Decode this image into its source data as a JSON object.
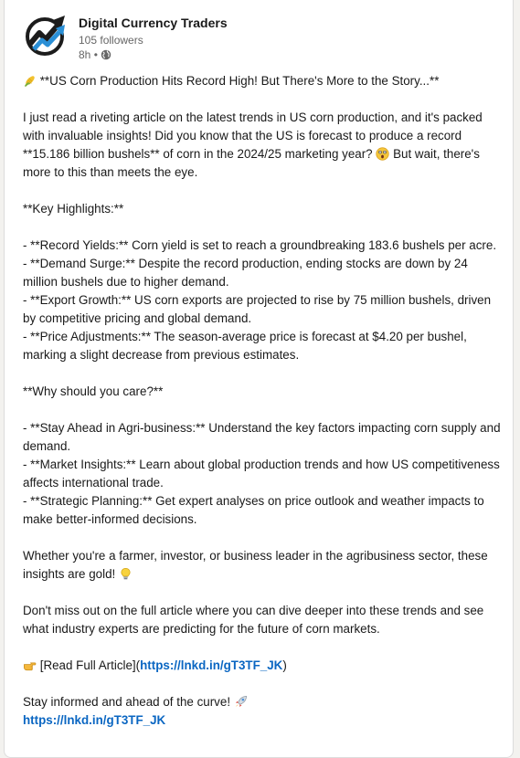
{
  "post": {
    "author": {
      "name": "Digital Currency Traders",
      "followers": "105 followers",
      "time": "8h",
      "separator": "•",
      "visibility_icon": "globe-icon",
      "avatar_icon": "trend-arrow-logo"
    },
    "title_emoji": "corn-icon",
    "title": " **US Corn Production Hits Record High! But There's More to the Story...**",
    "intro_1": "I just read a riveting article on the latest trends in US corn production, and it's packed with invaluable insights! Did you know that the US is forecast to produce a record **15.186 billion bushels** of corn in the 2024/25 marketing year? ",
    "intro_emoji": "astonished-face-icon",
    "intro_2": " But wait, there's more to this than meets the eye.",
    "highlights_heading": "**Key Highlights:**",
    "highlights": [
      "- **Record Yields:** Corn yield is set to reach a groundbreaking 183.6 bushels per acre.",
      "- **Demand Surge:** Despite the record production, ending stocks are down by 24 million bushels due to higher demand.",
      "- **Export Growth:** US corn exports are projected to rise by 75 million bushels, driven by competitive pricing and global demand.",
      "- **Price Adjustments:** The season-average price is forecast at $4.20 per bushel, marking a slight decrease from previous estimates."
    ],
    "care_heading": "**Why should you care?**",
    "care_points": [
      "- **Stay Ahead in Agri-business:** Understand the key factors impacting corn supply and demand.",
      "- **Market Insights:** Learn about global production trends and how US competitiveness affects international trade.",
      "- **Strategic Planning:** Get expert analyses on price outlook and weather impacts to make better-informed decisions."
    ],
    "audience_text": "Whether you're a farmer, investor, or business leader in the agribusiness sector, these insights are gold! ",
    "audience_emoji": "light-bulb-icon",
    "cta_text": "Don't miss out on the full article where you can dive deeper into these trends and see what industry experts are predicting for the future of corn markets.",
    "read_emoji": "pointing-hand-icon",
    "read_prefix": " [Read Full Article](",
    "read_link": "https://lnkd.in/gT3TF_JK",
    "read_suffix": ")",
    "closing_text": "Stay informed and ahead of the curve! ",
    "closing_emoji": "rocket-icon",
    "final_link": "https://lnkd.in/gT3TF_JK"
  },
  "colors": {
    "link": "#0a66c2",
    "secondary_text": "#666666",
    "logo_blue": "#2a8fd6",
    "logo_dark": "#1c1c1c"
  }
}
